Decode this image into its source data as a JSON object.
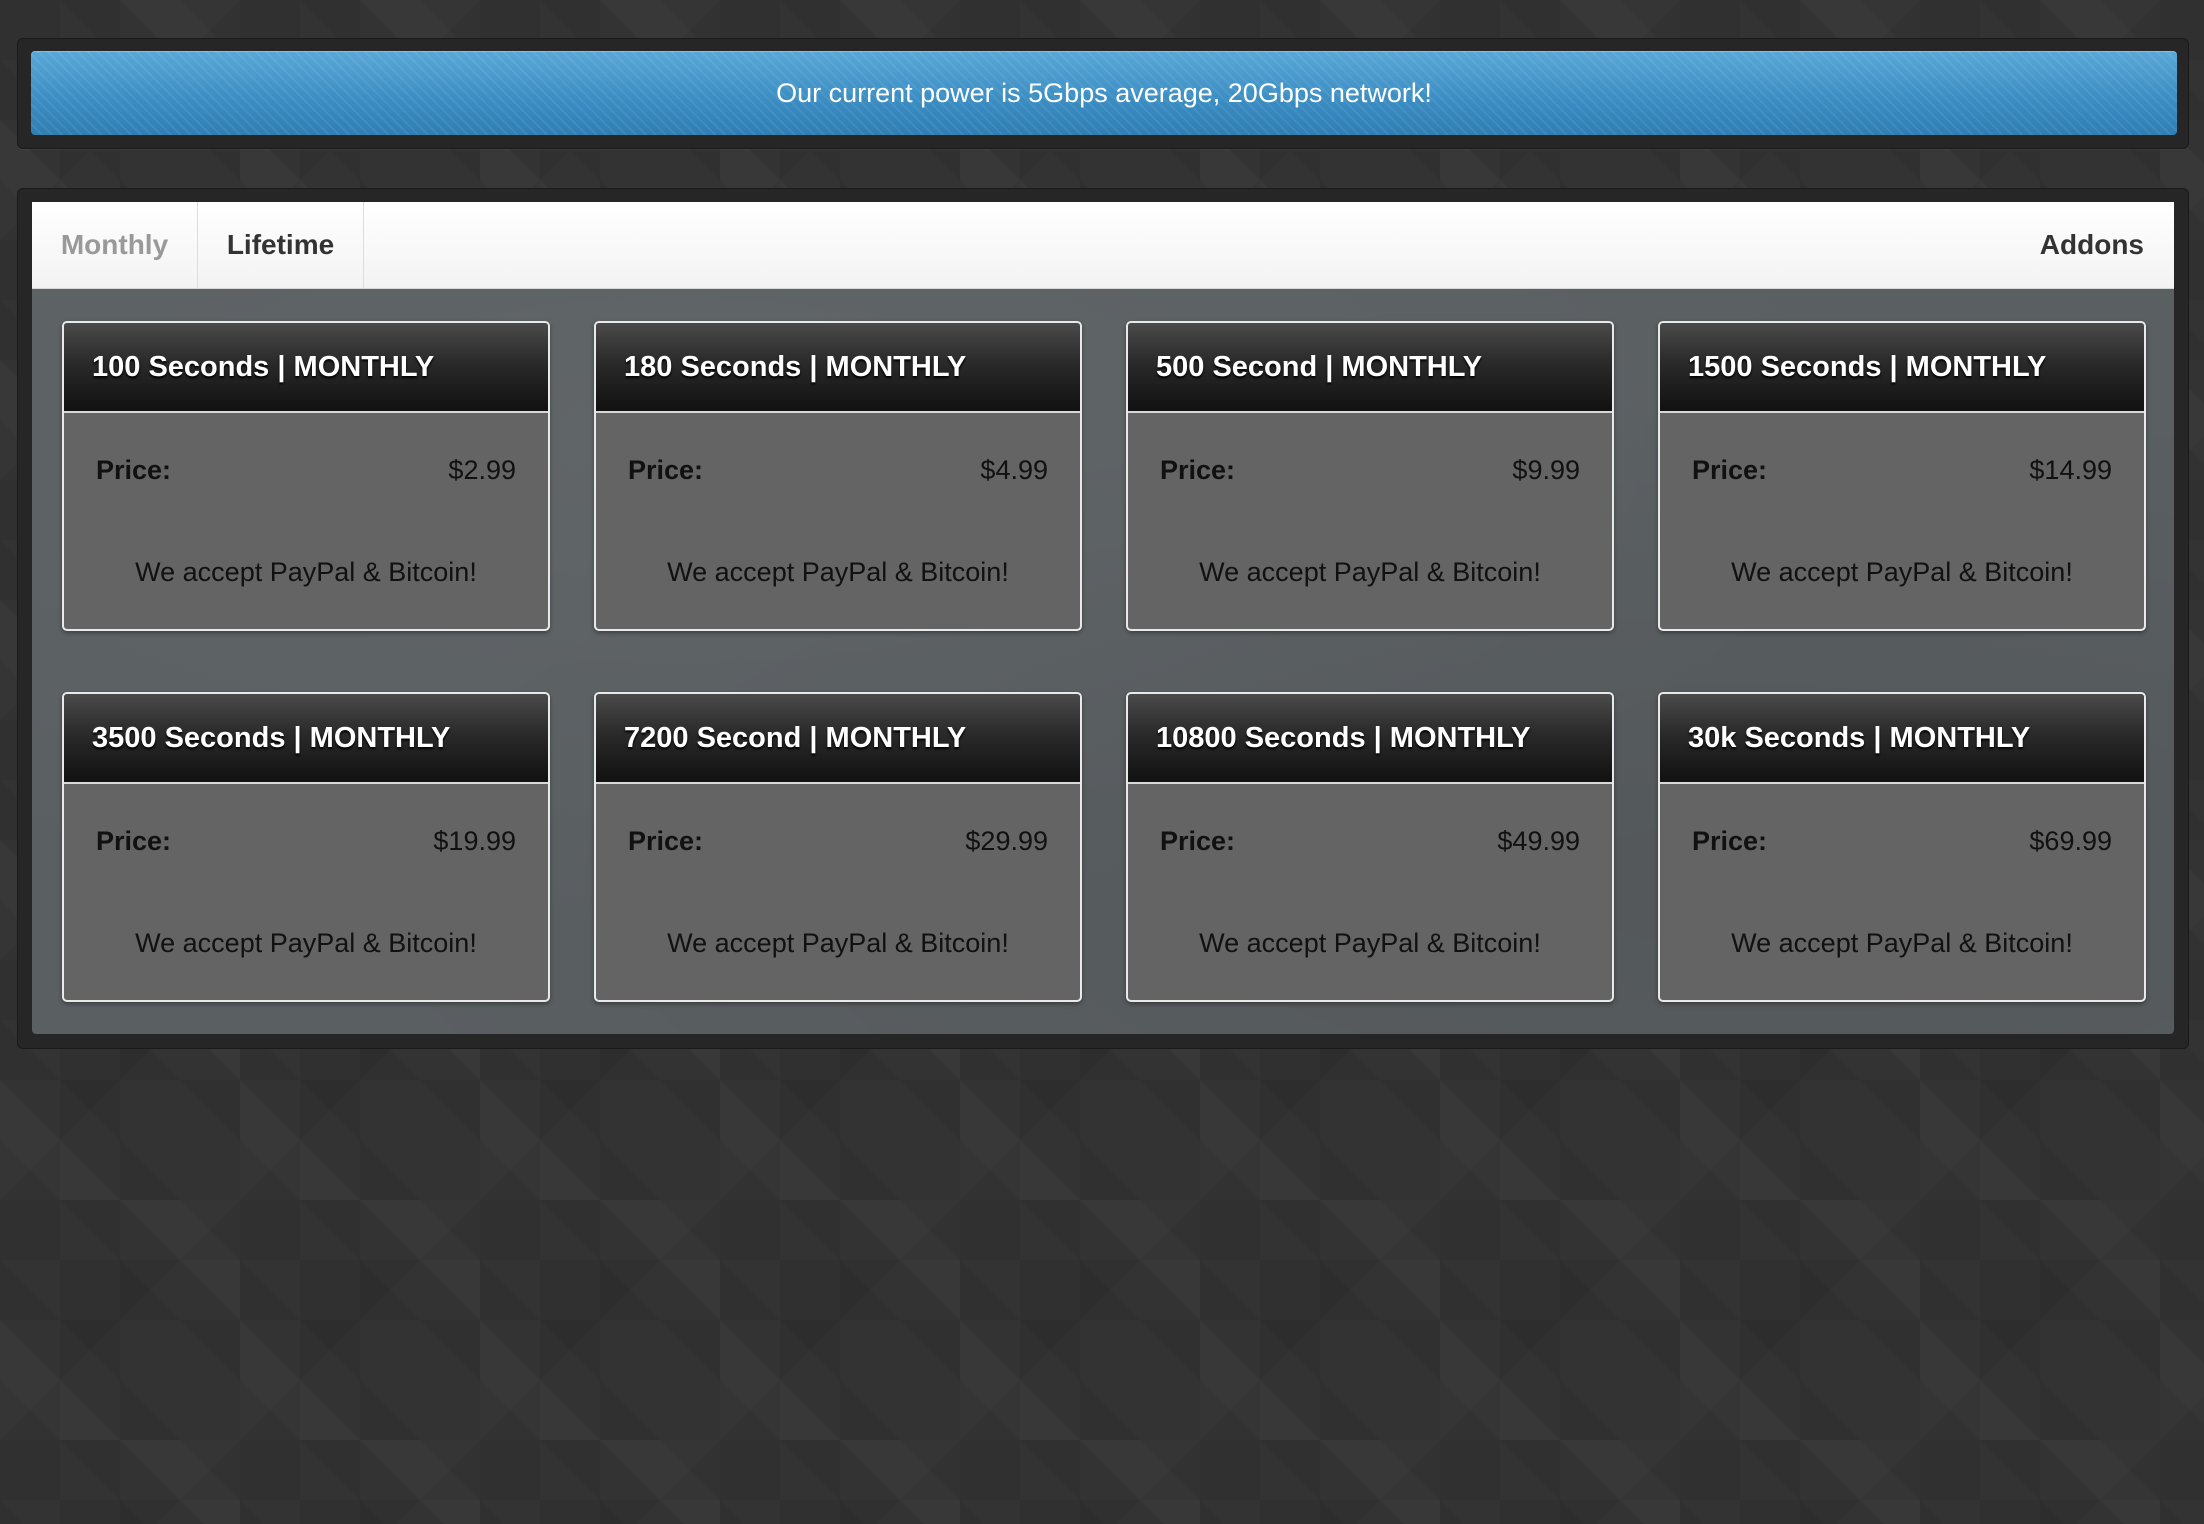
{
  "banner": {
    "text": "Our current power is 5Gbps average, 20Gbps network!"
  },
  "tabs": {
    "monthly": "Monthly",
    "lifetime": "Lifetime",
    "addons": "Addons",
    "active": "Monthly"
  },
  "plans": [
    {
      "title": "100 Seconds | MONTHLY",
      "price_label": "Price:",
      "price": "$2.99",
      "note": "We accept PayPal & Bitcoin!"
    },
    {
      "title": "180 Seconds | MONTHLY",
      "price_label": "Price:",
      "price": "$4.99",
      "note": "We accept PayPal & Bitcoin!"
    },
    {
      "title": "500 Second | MONTHLY",
      "price_label": "Price:",
      "price": "$9.99",
      "note": "We accept PayPal & Bitcoin!"
    },
    {
      "title": "1500 Seconds | MONTHLY",
      "price_label": "Price:",
      "price": "$14.99",
      "note": "We accept PayPal & Bitcoin!"
    },
    {
      "title": "3500 Seconds | MONTHLY",
      "price_label": "Price:",
      "price": "$19.99",
      "note": "We accept PayPal & Bitcoin!"
    },
    {
      "title": "7200 Second | MONTHLY",
      "price_label": "Price:",
      "price": "$29.99",
      "note": "We accept PayPal & Bitcoin!"
    },
    {
      "title": "10800 Seconds | MONTHLY",
      "price_label": "Price:",
      "price": "$49.99",
      "note": "We accept PayPal & Bitcoin!"
    },
    {
      "title": "30k Seconds | MONTHLY",
      "price_label": "Price:",
      "price": "$69.99",
      "note": "We accept PayPal & Bitcoin!"
    }
  ],
  "colors": {
    "banner_blue": "#3c8fc4",
    "page_background": "#333333",
    "card_body": "#646464",
    "card_header": "#1a1a1a",
    "content_background": "#5a5f62"
  }
}
